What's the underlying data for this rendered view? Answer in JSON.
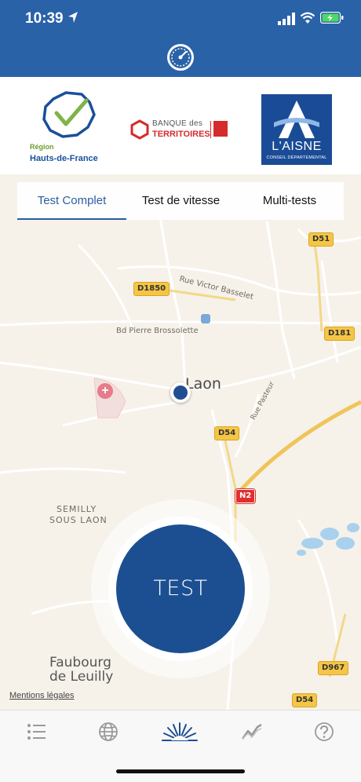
{
  "status_bar": {
    "time": "10:39"
  },
  "logos": {
    "region": {
      "line1": "Région",
      "line2": "Hauts-de-France"
    },
    "banque": {
      "line1": "BANQUE des",
      "line2": "TERRITOIRES"
    },
    "aisne": {
      "name": "L'AISNE",
      "subtitle": "CONSEIL DÉPARTEMENTAL"
    }
  },
  "tabs": [
    {
      "label": "Test Complet",
      "active": true
    },
    {
      "label": "Test de vitesse",
      "active": false
    },
    {
      "label": "Multi-tests",
      "active": false
    }
  ],
  "map": {
    "city": "Laon",
    "streets": [
      "Rue Victor Basselet",
      "Bd Pierre Brossolette",
      "Rue Pasteur"
    ],
    "places": {
      "semilly_1": "SEMILLY",
      "semilly_2": "SOUS LAON",
      "faubourg_1": "Faubourg",
      "faubourg_2": "de Leuilly"
    },
    "roads": [
      "D51",
      "D1850",
      "D181",
      "D54",
      "N2",
      "D967",
      "D54"
    ]
  },
  "test_button": {
    "label": "TEST"
  },
  "legal_link": "Mentions légales",
  "bottom_tabs": [
    {
      "icon": "list-icon",
      "active": false
    },
    {
      "icon": "globe-icon",
      "active": false
    },
    {
      "icon": "speed-burst-icon",
      "active": true
    },
    {
      "icon": "chart-line-icon",
      "active": false
    },
    {
      "icon": "help-icon",
      "active": false
    }
  ],
  "colors": {
    "brand": "#2a62a8",
    "test_button": "#1b4f91",
    "active_tab": "#2a5ea0",
    "road_badge": "#f5c646",
    "national_road": "#e02e2e"
  }
}
